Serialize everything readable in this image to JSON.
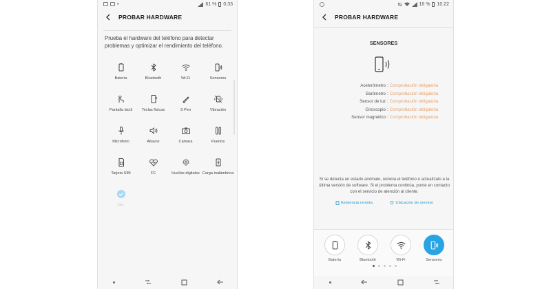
{
  "left_phone": {
    "status": {
      "battery": "61 %",
      "time": "0:33"
    },
    "title": "PROBAR HARDWARE",
    "description": "Prueba el hardware del teléfono para detectar problemas y optimizar el rendimiento del teléfono.",
    "items": [
      {
        "label": "Batería",
        "icon": "battery-icon"
      },
      {
        "label": "Bluetooth",
        "icon": "bluetooth-icon"
      },
      {
        "label": "Wi-Fi",
        "icon": "wifi-icon"
      },
      {
        "label": "Sensores",
        "icon": "sensors-icon"
      },
      {
        "label": "Pantalla táctil",
        "icon": "touch-icon"
      },
      {
        "label": "Teclas físicas",
        "icon": "phone-keys-icon"
      },
      {
        "label": "S Pen",
        "icon": "pen-icon"
      },
      {
        "label": "Vibración",
        "icon": "vibration-icon"
      },
      {
        "label": "Micrófono",
        "icon": "microphone-icon"
      },
      {
        "label": "Altavoz",
        "icon": "speaker-icon"
      },
      {
        "label": "Cámara",
        "icon": "camera-icon"
      },
      {
        "label": "Puertos",
        "icon": "ports-icon"
      },
      {
        "label": "Tarjeta SIM",
        "icon": "sim-icon"
      },
      {
        "label": "FC",
        "icon": "heart-rate-icon"
      },
      {
        "label": "Huellas digitales",
        "icon": "fingerprint-icon"
      },
      {
        "label": "Carga inalámbrica",
        "icon": "wireless-charging-icon"
      },
      {
        "label": "Iris",
        "icon": "check-circle-icon"
      }
    ]
  },
  "right_phone": {
    "status": {
      "battery": "16 %",
      "time": "10:22"
    },
    "title": "PROBAR HARDWARE",
    "section_title": "SENSORES",
    "sensors": [
      {
        "name": "Acelerómetro",
        "status": "Comprobación obligatoria"
      },
      {
        "name": "Barómetro",
        "status": "Comprobación obligatoria"
      },
      {
        "name": "Sensor de luz",
        "status": "Comprobación obligatoria"
      },
      {
        "name": "Giroscopio",
        "status": "Comprobación obligatoria"
      },
      {
        "name": "Sensor magnético",
        "status": "Comprobación obligatoria"
      }
    ],
    "separator": ":",
    "warning": "Si se detecta un estado anómalo, reinicia el teléfono o actualízalo a la última versión de software. Si el problema continúa, ponte en contacto con el servicio de atención al cliente.",
    "links": {
      "remote": "Asistencia remota",
      "service": "Ubicación de servicio"
    },
    "tabs": [
      {
        "label": "Batería",
        "icon": "battery-icon"
      },
      {
        "label": "Bluetooth",
        "icon": "bluetooth-icon"
      },
      {
        "label": "Wi-Fi",
        "icon": "wifi-icon"
      },
      {
        "label": "Sensores",
        "icon": "sensors-icon"
      }
    ],
    "pager": {
      "pages": 5,
      "current": 1
    }
  },
  "colors": {
    "accent": "#29a4e3",
    "warning_text": "#e9a067",
    "link": "#2a9ad7"
  }
}
